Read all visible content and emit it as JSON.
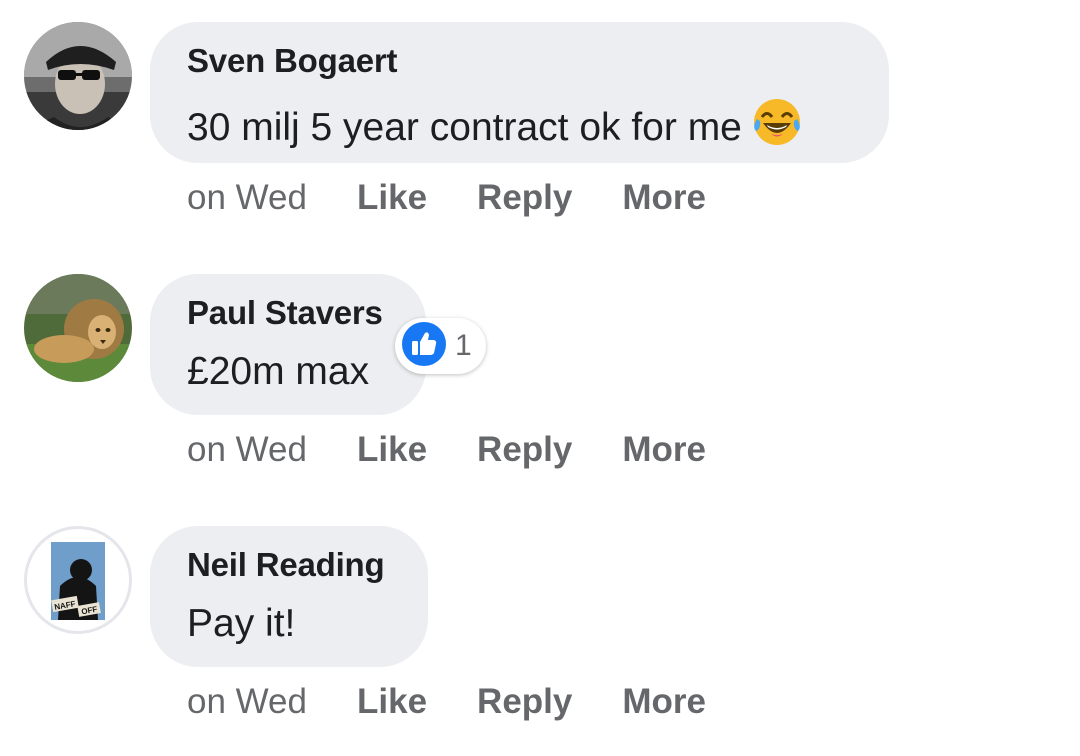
{
  "comments": [
    {
      "author": "Sven Bogaert",
      "text": "30 milj 5 year contract ok for me",
      "emoji": "laughing-crying-emoji",
      "time": "on Wed",
      "actions": [
        "Like",
        "Reply",
        "More"
      ]
    },
    {
      "author": "Paul Stavers",
      "text": "£20m max",
      "reaction": {
        "icon": "like-thumbs-up-icon",
        "count": "1",
        "color": "#1877f2"
      },
      "time": "on Wed",
      "actions": [
        "Like",
        "Reply",
        "More"
      ]
    },
    {
      "author": "Neil Reading",
      "text": "Pay it!",
      "avatar_text": "NAFF OFF",
      "time": "on Wed",
      "actions": [
        "Like",
        "Reply",
        "More"
      ]
    }
  ],
  "colors": {
    "bubble": "#eceef1",
    "text": "#1c1e21",
    "secondary_text": "#65676b",
    "like_blue": "#1877f2"
  }
}
